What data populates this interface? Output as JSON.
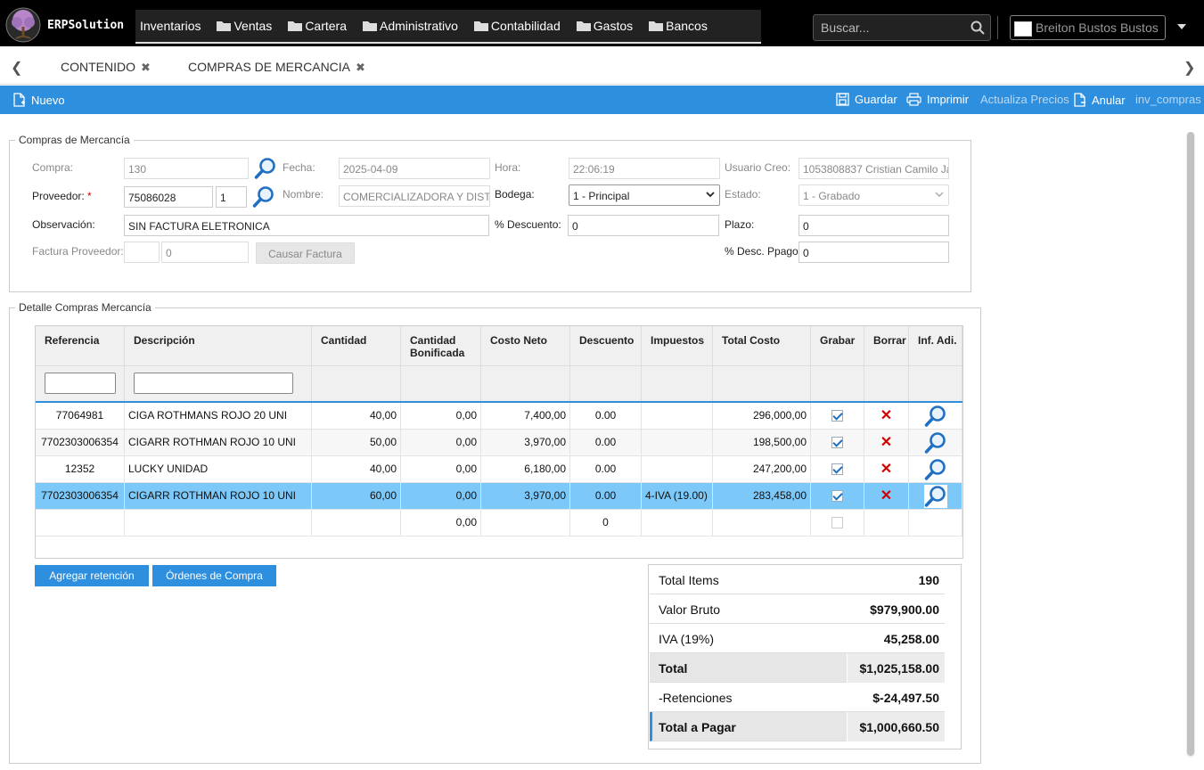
{
  "app": {
    "brand": "ERPSolution",
    "nav": [
      {
        "label": "Inventarios",
        "folder": false
      },
      {
        "label": "Ventas",
        "folder": true
      },
      {
        "label": "Cartera",
        "folder": true
      },
      {
        "label": "Administrativo",
        "folder": true
      },
      {
        "label": "Contabilidad",
        "folder": true
      },
      {
        "label": "Gastos",
        "folder": true
      },
      {
        "label": "Bancos",
        "folder": true
      }
    ],
    "search_placeholder": "Buscar...",
    "user_name": "Breiton Bustos Bustos"
  },
  "tabs": [
    {
      "label": "CONTENIDO"
    },
    {
      "label": "COMPRAS DE MERCANCIA"
    }
  ],
  "toolbar": {
    "nuevo": "Nuevo",
    "guardar": "Guardar",
    "imprimir": "Imprimir",
    "actualiza": "Actualiza Precios",
    "anular": "Anular",
    "module": "inv_compras"
  },
  "header": {
    "legend": "Compras de Mercancía",
    "labels": {
      "compra": "Compra:",
      "fecha": "Fecha:",
      "hora": "Hora:",
      "usuario": "Usuario Creo:",
      "proveedor": "Proveedor:",
      "nombre": "Nombre:",
      "bodega": "Bodega:",
      "estado": "Estado:",
      "observacion": "Observación:",
      "descuento": "% Descuento:",
      "plazo": "Plazo:",
      "factura": "Factura Proveedor:",
      "desc_ppago": "% Desc. Ppago"
    },
    "values": {
      "compra": "130",
      "fecha": "2025-04-09",
      "hora": "22:06:19",
      "usuario": "1053808837 Cristian Camilo Ja",
      "proveedor": "75086028",
      "proveedor_suc": "1",
      "nombre": "COMERCIALIZADORA Y DISTR",
      "bodega": "1 - Principal",
      "estado": "1 - Grabado",
      "observacion": "SIN FACTURA ELETRONICA",
      "descuento": "0",
      "plazo": "0",
      "factura_prefijo": "",
      "factura_numero": "0",
      "desc_ppago": "0"
    },
    "causar_button": "Causar Factura"
  },
  "detail": {
    "legend": "Detalle Compras Mercancía",
    "columns": [
      "Referencia",
      "Descripción",
      "Cantidad",
      "Cantidad Bonificada",
      "Costo Neto",
      "Descuento",
      "Impuestos",
      "Total Costo",
      "Grabar",
      "Borrar",
      "Inf. Adi."
    ],
    "rows": [
      {
        "ref": "77064981",
        "desc": "CIGA ROTHMANS ROJO 20 UNI",
        "cant": "40,00",
        "bonif": "0,00",
        "costo": "7,400,00",
        "dcto": "0.00",
        "imp": "",
        "total": "296,000,00",
        "grabar": true
      },
      {
        "ref": "7702303006354",
        "desc": "CIGARR ROTHMAN ROJO 10 UNI",
        "cant": "50,00",
        "bonif": "0,00",
        "costo": "3,970,00",
        "dcto": "0.00",
        "imp": "",
        "total": "198,500,00",
        "grabar": true
      },
      {
        "ref": "12352",
        "desc": "LUCKY UNIDAD",
        "cant": "40,00",
        "bonif": "0,00",
        "costo": "6,180,00",
        "dcto": "0.00",
        "imp": "",
        "total": "247,200,00",
        "grabar": true
      },
      {
        "ref": "7702303006354",
        "desc": "CIGARR ROTHMAN ROJO 10 UNI",
        "cant": "60,00",
        "bonif": "0,00",
        "costo": "3,970,00",
        "dcto": "0.00",
        "imp": "4-IVA (19.00)",
        "total": "283,458,00",
        "grabar": true
      }
    ],
    "new_row": {
      "bonif": "0,00",
      "dcto": "0"
    }
  },
  "buttons": {
    "retencion": "Agregar retención",
    "ordenes": "Órdenes de Compra"
  },
  "totals": [
    {
      "label": "Total Items",
      "value": "190"
    },
    {
      "label": "Valor Bruto",
      "value": "$979,900.00"
    },
    {
      "label": "IVA (19%)",
      "value": "45,258.00"
    },
    {
      "label": "Total",
      "value": "$1,025,158.00"
    },
    {
      "label": "-Retenciones",
      "value": "$-24,497.50"
    },
    {
      "label": "Total a Pagar",
      "value": "$1,000,660.50"
    }
  ],
  "colors": {
    "accent": "#2e8fde",
    "selected_row": "#7cc8f8",
    "delete": "#d40000"
  }
}
